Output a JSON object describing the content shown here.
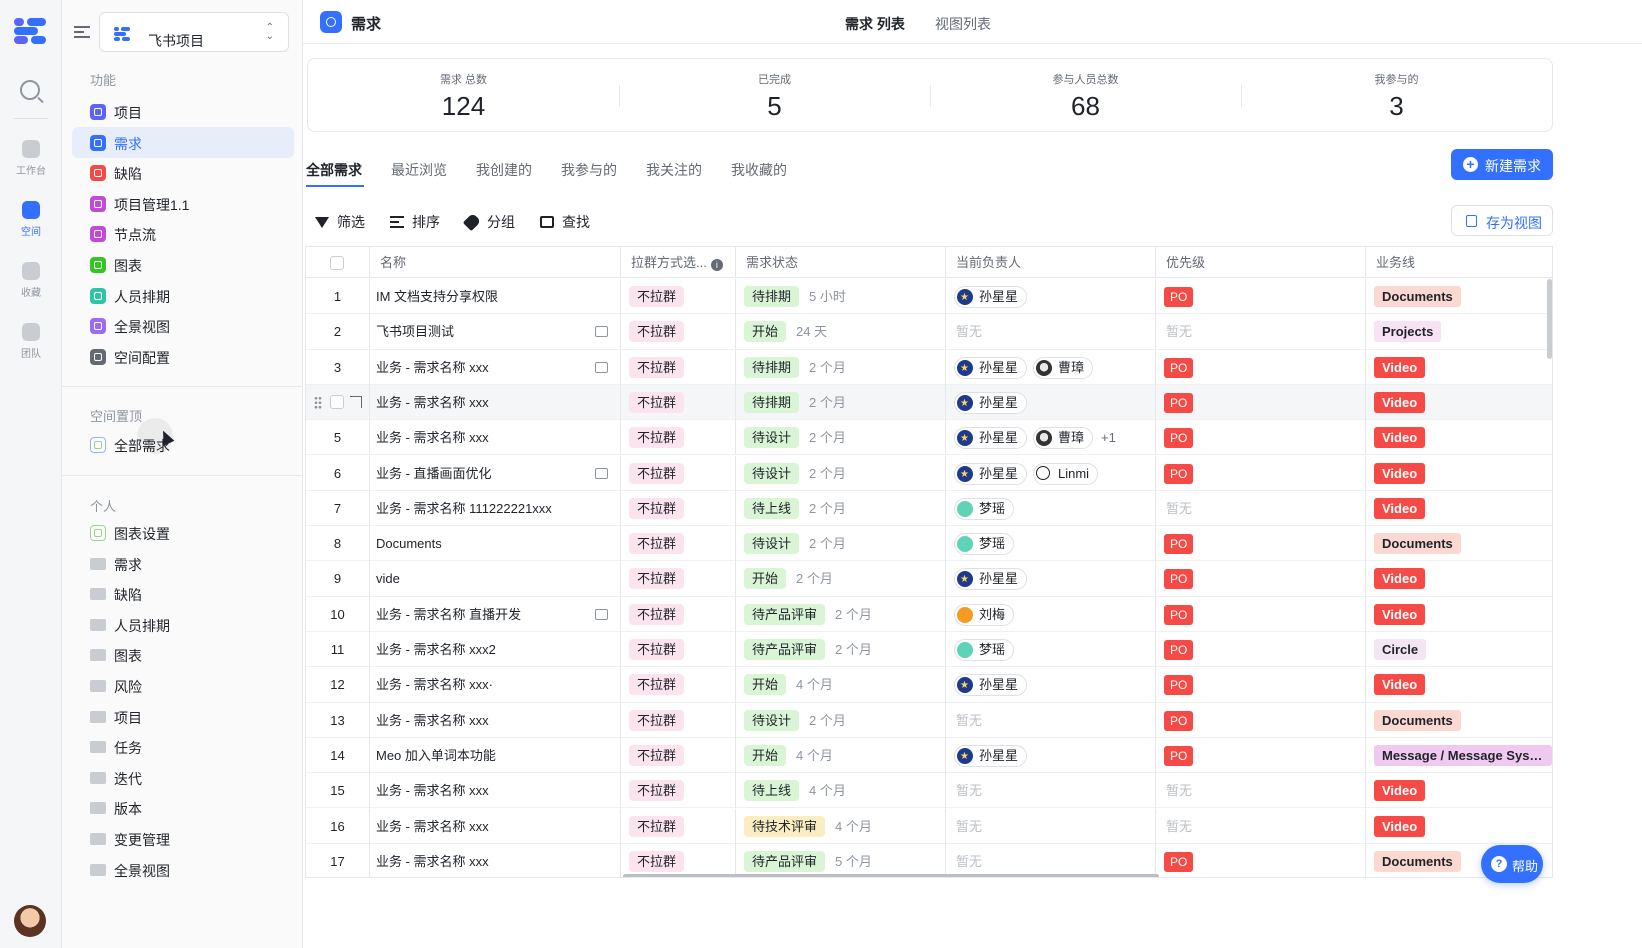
{
  "rail": {
    "items": [
      {
        "label": "工作台"
      },
      {
        "label": "空间"
      },
      {
        "label": "收藏"
      },
      {
        "label": "团队"
      }
    ]
  },
  "sidebar": {
    "project_name": "飞书项目",
    "section_features": "功能",
    "features": [
      {
        "label": "项目",
        "color": "#5b65f5"
      },
      {
        "label": "需求",
        "color": "#3370ff"
      },
      {
        "label": "缺陷",
        "color": "#f54a45"
      },
      {
        "label": "项目管理1.1",
        "color": "#c14ad6"
      },
      {
        "label": "节点流",
        "color": "#c14ad6"
      },
      {
        "label": "图表",
        "color": "#34c724"
      },
      {
        "label": "人员排期",
        "color": "#2ec4a5"
      },
      {
        "label": "全景视图",
        "color": "#9b6bf5"
      },
      {
        "label": "空间配置",
        "color": "#646a73"
      }
    ],
    "section_pinned": "空间置顶",
    "pinned": [
      {
        "label": "全部需求"
      }
    ],
    "section_personal": "个人",
    "personal": [
      {
        "label": "图表设置"
      },
      {
        "label": "需求"
      },
      {
        "label": "缺陷"
      },
      {
        "label": "人员排期"
      },
      {
        "label": "图表"
      },
      {
        "label": "风险"
      },
      {
        "label": "项目"
      },
      {
        "label": "任务"
      },
      {
        "label": "迭代"
      },
      {
        "label": "版本"
      },
      {
        "label": "变更管理"
      },
      {
        "label": "全景视图"
      }
    ]
  },
  "header": {
    "title": "需求",
    "view_tabs": [
      "需求 列表",
      "视图列表"
    ]
  },
  "stats": [
    {
      "label": "需求 总数",
      "value": "124"
    },
    {
      "label": "已完成",
      "value": "5"
    },
    {
      "label": "参与人员总数",
      "value": "68"
    },
    {
      "label": "我参与的",
      "value": "3"
    }
  ],
  "tabs": [
    "全部需求",
    "最近浏览",
    "我创建的",
    "我参与的",
    "我关注的",
    "我收藏的"
  ],
  "new_button": "新建需求",
  "toolbar": {
    "filter": "筛选",
    "sort": "排序",
    "group": "分组",
    "find": "查找",
    "save_view": "存为视图"
  },
  "table": {
    "columns": [
      "名称",
      "拉群方式选...",
      "需求状态",
      "当前负责人",
      "优先级",
      "业务线"
    ],
    "empty_text": "暂无",
    "rows": [
      {
        "idx": "1",
        "name": "IM 文档支持分享权限",
        "comment": false,
        "group": "不拉群",
        "status": "待排期",
        "status_color": "green",
        "time": "5 小时",
        "owners": [
          {
            "name": "孙星星",
            "av": "star"
          }
        ],
        "more": "",
        "priority": "PO",
        "biz": "Documents",
        "biz_style": "doc"
      },
      {
        "idx": "2",
        "name": "飞书项目测试",
        "comment": true,
        "group": "不拉群",
        "status": "开始",
        "status_color": "green",
        "time": "24 天",
        "owners": [],
        "more": "",
        "priority": "",
        "biz": "Projects",
        "biz_style": "proj"
      },
      {
        "idx": "3",
        "name": "业务 - 需求名称 xxx",
        "comment": true,
        "group": "不拉群",
        "status": "待排期",
        "status_color": "green",
        "time": "2 个月",
        "owners": [
          {
            "name": "孙星星",
            "av": "star"
          },
          {
            "name": "曹璋",
            "av": "photo"
          }
        ],
        "more": "",
        "priority": "PO",
        "biz": "Video",
        "biz_style": "vid"
      },
      {
        "idx": "",
        "name": "业务 - 需求名称 xxx",
        "comment": false,
        "group": "不拉群",
        "status": "待排期",
        "status_color": "green",
        "time": "2 个月",
        "owners": [
          {
            "name": "孙星星",
            "av": "star"
          }
        ],
        "more": "",
        "priority": "PO",
        "biz": "Video",
        "biz_style": "vid",
        "hover": true
      },
      {
        "idx": "5",
        "name": "业务 - 需求名称 xxx",
        "comment": false,
        "group": "不拉群",
        "status": "待设计",
        "status_color": "green",
        "time": "2 个月",
        "owners": [
          {
            "name": "孙星星",
            "av": "star"
          },
          {
            "name": "曹璋",
            "av": "photo"
          }
        ],
        "more": "+1",
        "priority": "PO",
        "biz": "Video",
        "biz_style": "vid"
      },
      {
        "idx": "6",
        "name": "业务 - 直播画面优化",
        "comment": true,
        "group": "不拉群",
        "status": "待设计",
        "status_color": "green",
        "time": "2 个月",
        "owners": [
          {
            "name": "孙星星",
            "av": "star"
          },
          {
            "name": "Linmi",
            "av": "line"
          }
        ],
        "more": "",
        "priority": "PO",
        "biz": "Video",
        "biz_style": "vid"
      },
      {
        "idx": "7",
        "name": "业务 - 需求名称 111222221xxx",
        "comment": false,
        "group": "不拉群",
        "status": "待上线",
        "status_color": "green",
        "time": "2 个月",
        "owners": [
          {
            "name": "梦瑶",
            "av": "mint"
          }
        ],
        "more": "",
        "priority": "",
        "biz": "Video",
        "biz_style": "vid"
      },
      {
        "idx": "8",
        "name": "Documents",
        "comment": false,
        "group": "不拉群",
        "status": "待设计",
        "status_color": "green",
        "time": "2 个月",
        "owners": [
          {
            "name": "梦瑶",
            "av": "mint"
          }
        ],
        "more": "",
        "priority": "PO",
        "biz": "Documents",
        "biz_style": "doc"
      },
      {
        "idx": "9",
        "name": "vide",
        "comment": false,
        "group": "不拉群",
        "status": "开始",
        "status_color": "green",
        "time": "2 个月",
        "owners": [
          {
            "name": "孙星星",
            "av": "star"
          }
        ],
        "more": "",
        "priority": "PO",
        "biz": "Video",
        "biz_style": "vid"
      },
      {
        "idx": "10",
        "name": "业务 - 需求名称 直播开发",
        "comment": true,
        "group": "不拉群",
        "status": "待产品评审",
        "status_color": "green",
        "time": "2 个月",
        "owners": [
          {
            "name": "刘梅",
            "av": "orange"
          }
        ],
        "more": "",
        "priority": "PO",
        "biz": "Video",
        "biz_style": "vid"
      },
      {
        "idx": "11",
        "name": "业务 - 需求名称 xxx2",
        "comment": false,
        "group": "不拉群",
        "status": "待产品评审",
        "status_color": "green",
        "time": "2 个月",
        "owners": [
          {
            "name": "梦瑶",
            "av": "mint"
          }
        ],
        "more": "",
        "priority": "PO",
        "biz": "Circle",
        "biz_style": "circ"
      },
      {
        "idx": "12",
        "name": "业务 - 需求名称 xxx·",
        "comment": false,
        "group": "不拉群",
        "status": "开始",
        "status_color": "green",
        "time": "4 个月",
        "owners": [
          {
            "name": "孙星星",
            "av": "star"
          }
        ],
        "more": "",
        "priority": "PO",
        "biz": "Video",
        "biz_style": "vid"
      },
      {
        "idx": "13",
        "name": "业务 - 需求名称 xxx",
        "comment": false,
        "group": "不拉群",
        "status": "待设计",
        "status_color": "green",
        "time": "2 个月",
        "owners": [],
        "more": "",
        "priority": "PO",
        "biz": "Documents",
        "biz_style": "doc"
      },
      {
        "idx": "14",
        "name": "Meo 加入单词本功能",
        "comment": false,
        "group": "不拉群",
        "status": "开始",
        "status_color": "green",
        "time": "4 个月",
        "owners": [
          {
            "name": "孙星星",
            "av": "star"
          }
        ],
        "more": "",
        "priority": "PO",
        "biz": "Message / Message Syst...",
        "biz_style": "msg"
      },
      {
        "idx": "15",
        "name": "业务 - 需求名称 xxx",
        "comment": false,
        "group": "不拉群",
        "status": "待上线",
        "status_color": "green",
        "time": "4 个月",
        "owners": [],
        "more": "",
        "priority": "",
        "biz": "Video",
        "biz_style": "vid"
      },
      {
        "idx": "16",
        "name": "业务 - 需求名称 xxx",
        "comment": false,
        "group": "不拉群",
        "status": "待技术评审",
        "status_color": "yellow",
        "time": "4 个月",
        "owners": [],
        "more": "",
        "priority": "",
        "biz": "Video",
        "biz_style": "vid"
      },
      {
        "idx": "17",
        "name": "业务 - 需求名称 xxx",
        "comment": false,
        "group": "不拉群",
        "status": "待产品评审",
        "status_color": "green",
        "time": "5 个月",
        "owners": [],
        "more": "",
        "priority": "PO",
        "biz": "Documents",
        "biz_style": "doc"
      }
    ]
  },
  "help": "帮助"
}
